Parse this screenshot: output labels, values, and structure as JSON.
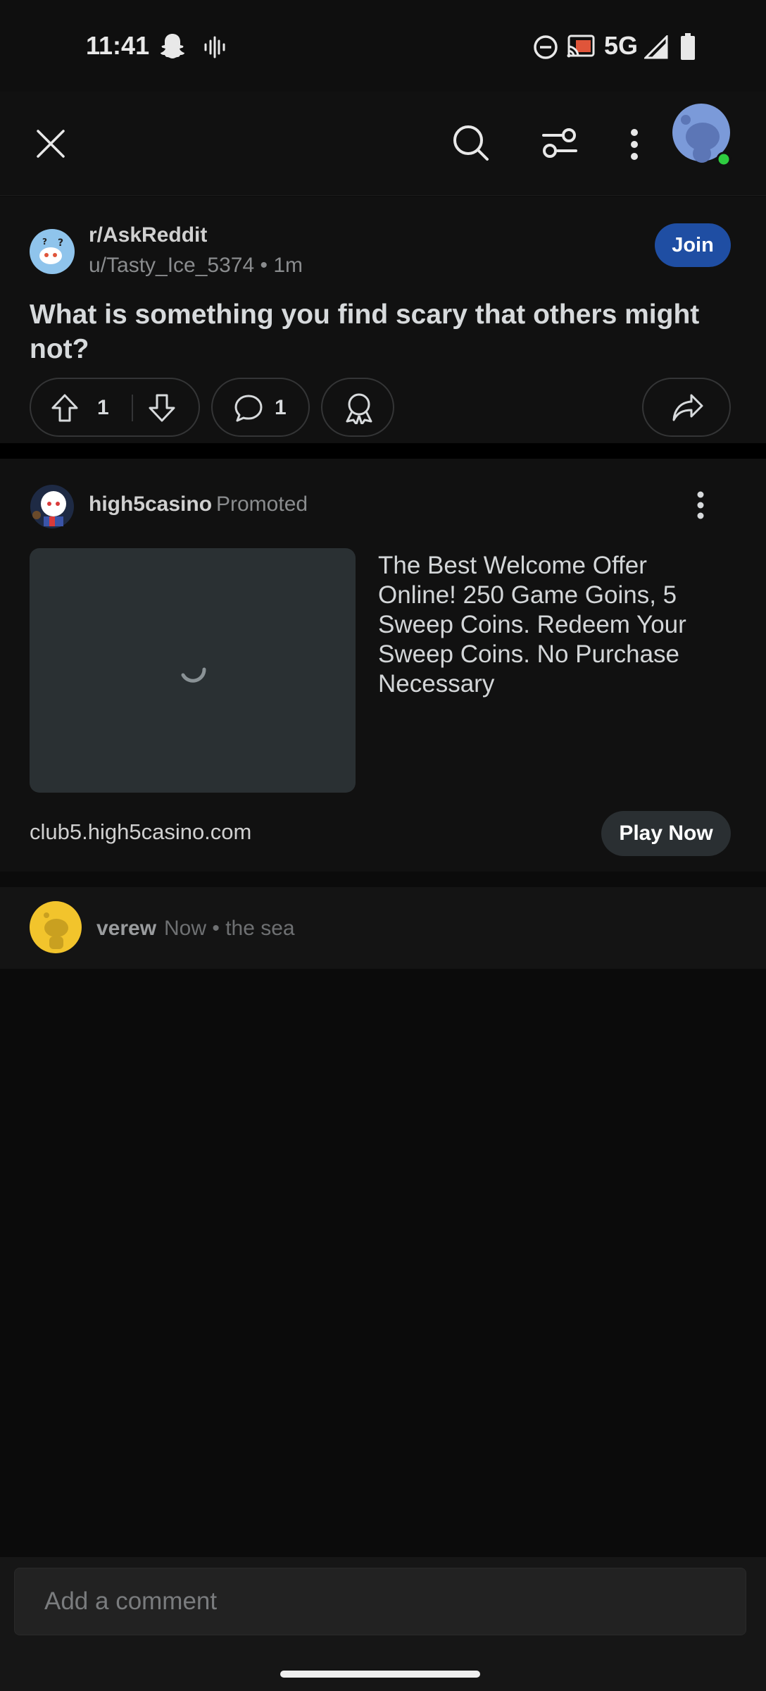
{
  "status_bar": {
    "time": "11:41",
    "network": "5G",
    "icons": [
      "snapchat-icon",
      "voice-icon",
      "do-not-disturb-icon",
      "cast-icon",
      "signal-icon",
      "battery-icon"
    ]
  },
  "app_bar": {
    "icons": [
      "close-icon",
      "search-icon",
      "sort-icon",
      "more-vertical-icon",
      "avatar-icon"
    ]
  },
  "post": {
    "subreddit": "r/AskReddit",
    "meta": "u/Tasty_Ice_5374 • 1m",
    "join_label": "Join",
    "title": "What is something you find scary that others might not?",
    "upvotes": "1",
    "comments": "1"
  },
  "ad": {
    "advertiser": "high5casino",
    "promoted_label": "Promoted",
    "text": "The Best Welcome Offer Online! 250 Game Goins, 5 Sweep Coins. Redeem Your Sweep Coins. No Purchase Necessary",
    "domain": "club5.high5casino.com",
    "cta_label": "Play Now"
  },
  "comment": {
    "author": "verew",
    "meta": "Now • the sea"
  },
  "bottom_bar": {
    "input_placeholder": "Add a comment"
  },
  "colors": {
    "join_button": "#1f4ea3",
    "background": "#0b0b0b",
    "card": "#111111",
    "avatar_blue": "#7b9ad9",
    "online_green": "#2ecc40",
    "comment_avatar": "#f2c42c"
  }
}
